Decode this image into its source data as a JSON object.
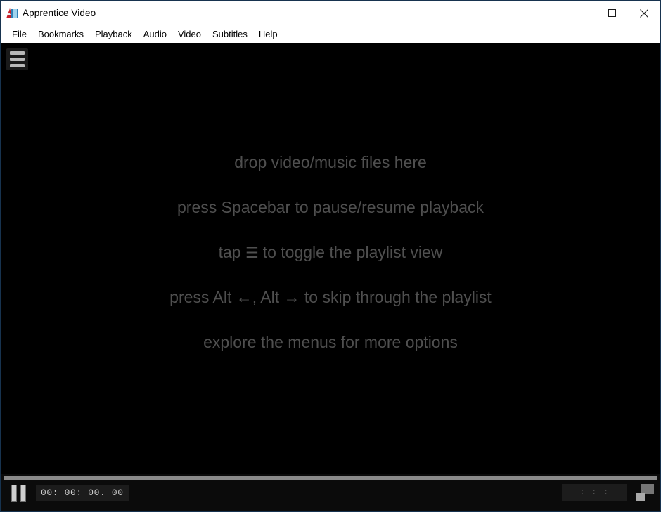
{
  "window": {
    "title": "Apprentice Video",
    "icon": "media-player-cone-icon",
    "controls": {
      "minimize_label": "—",
      "maximize_label": "□",
      "close_label": "✕"
    }
  },
  "menubar": {
    "items": [
      {
        "label": "File"
      },
      {
        "label": "Bookmarks"
      },
      {
        "label": "Playback"
      },
      {
        "label": "Audio"
      },
      {
        "label": "Video"
      },
      {
        "label": "Subtitles"
      },
      {
        "label": "Help"
      }
    ]
  },
  "video": {
    "background_color": "#000000",
    "playlist_toggle_name": "hamburger-icon",
    "hints": [
      {
        "text": "drop video/music files here"
      },
      {
        "text": "press Spacebar to pause/resume playback"
      },
      {
        "text_before": "tap ",
        "glyph": "☰",
        "text_after": " to toggle the playlist view"
      },
      {
        "text": "press Alt ←, Alt → to skip through the playlist"
      },
      {
        "text": "explore the menus for more options"
      }
    ],
    "hint_color": "#4f4f4f"
  },
  "controlbar": {
    "seek_position_percent": 0,
    "play_state": "paused",
    "play_pause_name": "pause-icon",
    "current_time": "00: 00: 00. 00",
    "total_time": ":     :     :",
    "fullscreen_name": "restore-window-icon",
    "track_color": "#8a8a8a"
  }
}
